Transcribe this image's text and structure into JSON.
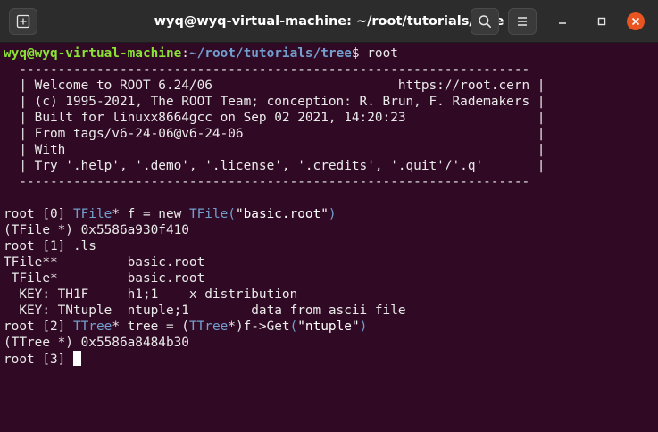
{
  "window": {
    "title": "wyq@wyq-virtual-machine: ~/root/tutorials/tree",
    "icons": [
      "new-tab-icon",
      "search-icon",
      "hamburger-menu-icon",
      "minimize-icon",
      "maximize-icon",
      "close-icon"
    ]
  },
  "colors": {
    "background": "#300a24",
    "prompt_user": "#8ae234",
    "prompt_path": "#729fcf",
    "class_name": "#729fcf",
    "close_button": "#e95420"
  },
  "prompt": {
    "user_host": "wyq@wyq-virtual-machine",
    "sep": ":",
    "path": "~/root/tutorials/tree",
    "dollar": "$",
    "command": " root"
  },
  "banner": {
    "border": "  ------------------------------------------------------------------",
    "lines": [
      "  | Welcome to ROOT 6.24/06                        https://root.cern |",
      "  | (c) 1995-2021, The ROOT Team; conception: R. Brun, F. Rademakers |",
      "  | Built for linuxx8664gcc on Sep 02 2021, 14:20:23                 |",
      "  | From tags/v6-24-06@v6-24-06                                      |",
      "  | With                                                             |",
      "  | Try '.help', '.demo', '.license', '.credits', '.quit'/'.q'       |"
    ]
  },
  "session": {
    "cmd0_prefix": "root [0] ",
    "cmd0_class1": "TFile",
    "cmd0_mid": "* f = new ",
    "cmd0_class2": "TFile",
    "cmd0_paren_open": "(",
    "cmd0_str": "\"basic.root\"",
    "cmd0_paren_close": ")",
    "out0": "(TFile *) 0x5586a930f410",
    "cmd1": "root [1] .ls",
    "ls_lines": [
      "TFile**         basic.root",
      " TFile*         basic.root",
      "  KEY: TH1F     h1;1    x distribution",
      "  KEY: TNtuple  ntuple;1        data from ascii file"
    ],
    "cmd2_prefix": "root [2] ",
    "cmd2_class1": "TTree",
    "cmd2_mid": "* tree = (",
    "cmd2_class2": "TTree",
    "cmd2_mid2": "*)f->Get",
    "cmd2_paren_open": "(",
    "cmd2_str": "\"ntuple\"",
    "cmd2_paren_close": ")",
    "out2": "(TTree *) 0x5586a8484b30",
    "cmd3_prefix": "root [3] "
  }
}
